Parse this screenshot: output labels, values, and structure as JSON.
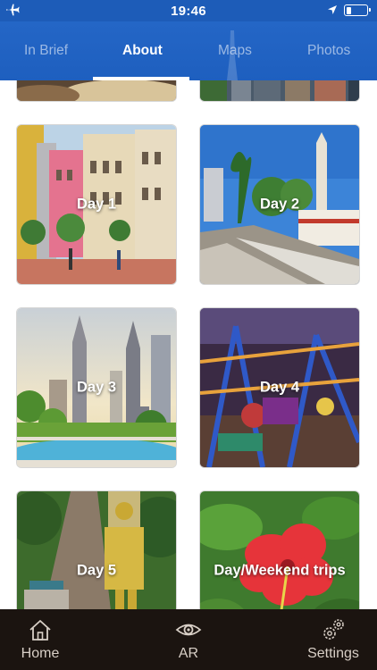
{
  "status_bar": {
    "time": "19:46",
    "icons": [
      "airplane-icon",
      "location-arrow-icon",
      "battery-icon"
    ],
    "battery_level": 0.2
  },
  "tabs": [
    {
      "label": "In Brief",
      "active": false
    },
    {
      "label": "About",
      "active": true
    },
    {
      "label": "Maps",
      "active": false
    },
    {
      "label": "Photos",
      "active": false
    }
  ],
  "days": [
    {
      "label": "Day 1"
    },
    {
      "label": "Day 2"
    },
    {
      "label": "Day 3"
    },
    {
      "label": "Day 4"
    },
    {
      "label": "Day 5"
    },
    {
      "label": "Day/Weekend trips"
    }
  ],
  "bottom_nav": [
    {
      "label": "Home",
      "icon": "home-icon"
    },
    {
      "label": "AR",
      "icon": "eye-icon"
    },
    {
      "label": "Settings",
      "icon": "gears-icon"
    }
  ],
  "colors": {
    "header_blue": "#1e5fbf",
    "bottom_bar": "#1b1410",
    "tab_inactive": "rgba(255,255,255,0.55)"
  }
}
